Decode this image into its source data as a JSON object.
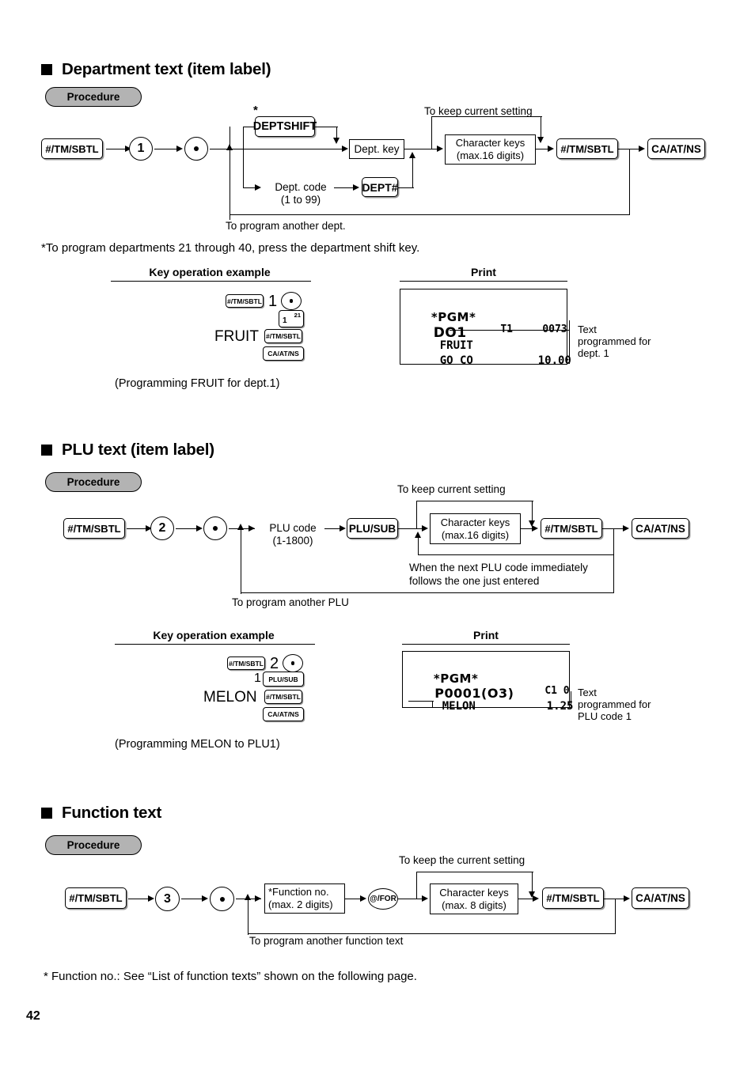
{
  "page": {
    "number": "42"
  },
  "sections": [
    {
      "id": "department-text",
      "title": "Department text (item label)",
      "procedure_label": "Procedure",
      "flow": {
        "start_key": "#/TM/SBTL",
        "mode_digit": "1",
        "dept_shift_key": "DEPTSHIFT",
        "dept_key": "Dept. key",
        "dept_code_line1": "Dept. code",
        "dept_code_line2": "(1 to 99)",
        "dept_num_key": "DEPT#",
        "keep_setting": "To keep current setting",
        "char_keys_line1": "Character keys",
        "char_keys_line2": "(max.16 digits)",
        "subtotal_key": "#/TM/SBTL",
        "finalize_key": "CA/AT/NS",
        "loop_label": "To program another dept.",
        "asterisk": "*"
      },
      "footnote": "*To program departments 21 through 40, press the department shift key.",
      "col_headers": {
        "left": "Key operation example",
        "right": "Print"
      },
      "key_example": {
        "row1_key": "#/TM/SBTL",
        "row1_digit": "1",
        "row1_dot": "•",
        "dept_key_label": "1",
        "dept_key_sup": "21",
        "text_entry": "FRUIT",
        "row3_key": "#/TM/SBTL",
        "row4_key": "CA/AT/NS",
        "caption": "(Programming FRUIT for dept.1)"
      },
      "print": {
        "line1": "*PGM*",
        "line2_left": "DO1",
        "line2_mid": "T1",
        "line2_right": "0073",
        "line3_left": "FRUIT",
        "line4_left": "GO CO",
        "line4_right": "10.00",
        "callout": "Text\nprogrammed for\ndept. 1"
      }
    },
    {
      "id": "plu-text",
      "title": "PLU text (item label)",
      "procedure_label": "Procedure",
      "flow": {
        "start_key": "#/TM/SBTL",
        "mode_digit": "2",
        "plu_code_line1": "PLU code",
        "plu_code_line2": "(1-1800)",
        "plu_sub_key": "PLU/SUB",
        "keep_setting": "To keep current setting",
        "char_keys_line1": "Character keys",
        "char_keys_line2": "(max.16 digits)",
        "subtotal_key": "#/TM/SBTL",
        "finalize_key": "CA/AT/NS",
        "next_note_line1": "When the next PLU code immediately",
        "next_note_line2": "follows the one just entered",
        "loop_label": "To program another PLU"
      },
      "col_headers": {
        "left": "Key operation example",
        "right": "Print"
      },
      "key_example": {
        "row1_key": "#/TM/SBTL",
        "row1_digit": "2",
        "row1_dot": "•",
        "plu_code": "1",
        "plu_sub_key": "PLU/SUB",
        "text_entry": "MELON",
        "row3_key": "#/TM/SBTL",
        "row4_key": "CA/AT/NS",
        "caption": "(Programming MELON to PLU1)"
      },
      "print": {
        "line1": "*PGM*",
        "line2_left": "P0001(O3)",
        "line2_right": "C1 0",
        "line3_left": "MELON",
        "line3_right": "1.25",
        "callout": "Text\nprogrammed for\nPLU code 1"
      }
    },
    {
      "id": "function-text",
      "title": "Function text",
      "procedure_label": "Procedure",
      "flow": {
        "start_key": "#/TM/SBTL",
        "mode_digit": "3",
        "func_no_line1": "*Function no.",
        "func_no_line2": "(max. 2 digits)",
        "at_for_key": "@/FOR",
        "keep_setting": "To keep the current setting",
        "char_keys_line1": "Character keys",
        "char_keys_line2": "(max. 8 digits)",
        "subtotal_key": "#/TM/SBTL",
        "finalize_key": "CA/AT/NS",
        "loop_label": "To program another function text"
      },
      "footnote": "* Function no.: See “List of function texts” shown on the following page."
    }
  ]
}
